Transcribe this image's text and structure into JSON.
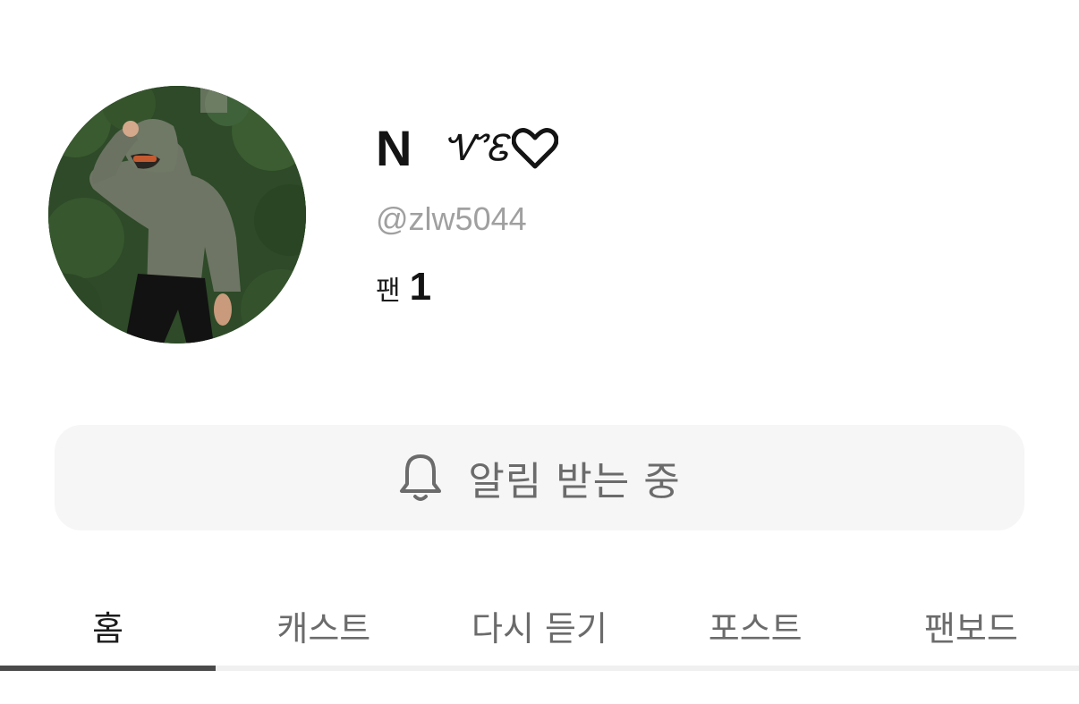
{
  "profile": {
    "name": "N",
    "name_deco": "ᏉᏋ",
    "handle": "@zlw5044",
    "fans_label": "팬",
    "fans_count": "1"
  },
  "notify_button": {
    "label": "알림 받는 중",
    "icon": "bell-icon"
  },
  "tabs": [
    {
      "label": "홈",
      "active": true
    },
    {
      "label": "캐스트",
      "active": false
    },
    {
      "label": "다시 듣기",
      "active": false
    },
    {
      "label": "포스트",
      "active": false
    },
    {
      "label": "팬보드",
      "active": false
    }
  ],
  "colors": {
    "tab_indicator": "#4a4a4a",
    "button_bg": "#f6f6f6",
    "handle_text": "#a0a0a0"
  }
}
